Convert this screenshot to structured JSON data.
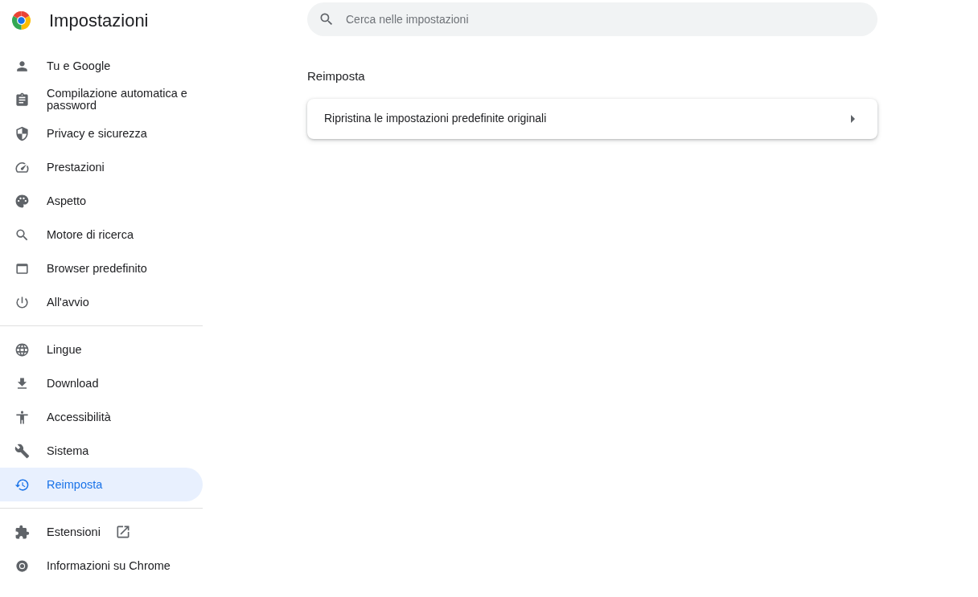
{
  "header": {
    "title": "Impostazioni"
  },
  "search": {
    "placeholder": "Cerca nelle impostazioni"
  },
  "sidebar": {
    "groups": [
      [
        {
          "label": "Tu e Google",
          "selected": false,
          "external": false
        },
        {
          "label": "Compilazione automatica e password",
          "selected": false,
          "external": false
        },
        {
          "label": "Privacy e sicurezza",
          "selected": false,
          "external": false
        },
        {
          "label": "Prestazioni",
          "selected": false,
          "external": false
        },
        {
          "label": "Aspetto",
          "selected": false,
          "external": false
        },
        {
          "label": "Motore di ricerca",
          "selected": false,
          "external": false
        },
        {
          "label": "Browser predefinito",
          "selected": false,
          "external": false
        },
        {
          "label": "All'avvio",
          "selected": false,
          "external": false
        }
      ],
      [
        {
          "label": "Lingue",
          "selected": false,
          "external": false
        },
        {
          "label": "Download",
          "selected": false,
          "external": false
        },
        {
          "label": "Accessibilità",
          "selected": false,
          "external": false
        },
        {
          "label": "Sistema",
          "selected": false,
          "external": false
        },
        {
          "label": "Reimposta",
          "selected": true,
          "external": false
        }
      ],
      [
        {
          "label": "Estensioni",
          "selected": false,
          "external": true
        },
        {
          "label": "Informazioni su Chrome",
          "selected": false,
          "external": false
        }
      ]
    ]
  },
  "section": {
    "title": "Reimposta",
    "rows": [
      {
        "label": "Ripristina le impostazioni predefinite originali"
      }
    ]
  }
}
